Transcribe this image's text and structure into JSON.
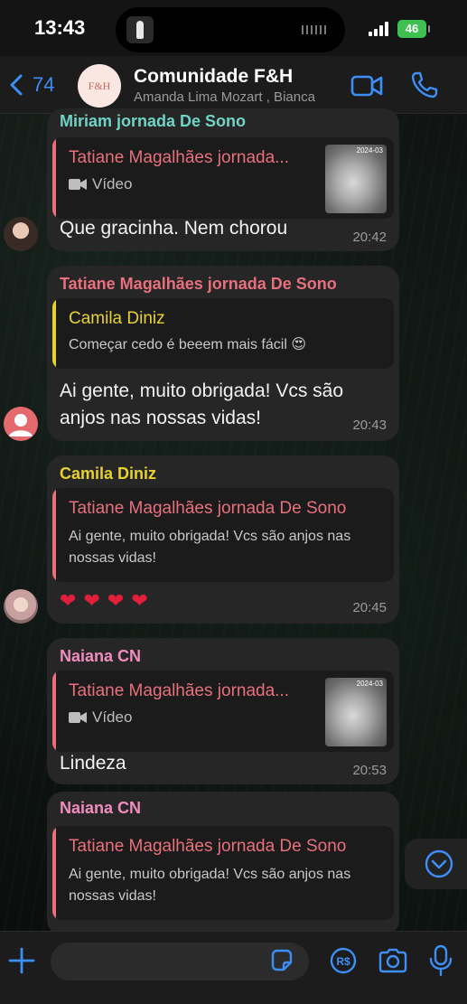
{
  "status_bar": {
    "time": "13:43",
    "battery": "46"
  },
  "header": {
    "back_count": "74",
    "avatar_text": "F&H",
    "group_name": "Comunidade F&H",
    "members": "Amanda Lima Mozart , Bianca",
    "icons": [
      "chevron-left-icon",
      "video-call-icon",
      "phone-icon"
    ]
  },
  "colors": {
    "accent": "#3d8ef7",
    "bubble": "#262626",
    "quote_bg": "#1b1b1b",
    "sender_miriam": "#6fd3c6",
    "sender_tatiane": "#e8707d",
    "sender_camila": "#e6d22e",
    "sender_naiana": "#f08cc0",
    "heart": "#e0203a"
  },
  "messages": [
    {
      "sender": "Miriam jornada De Sono",
      "quote_author": "Tatiane Magalhães jornada...",
      "quote_kind": "Vídeo",
      "thumb_timestamp": "2024-03",
      "text": "Que gracinha. Nem chorou",
      "time": "20:42"
    },
    {
      "sender": "Tatiane Magalhães jornada De Sono",
      "quote_author": "Camila  Diniz",
      "quote_text": "Começar cedo é beeem mais fácil 😍",
      "text": "Ai gente, muito obrigada! Vcs são\nanjos nas nossas vidas!",
      "time": "20:43"
    },
    {
      "sender": "Camila  Diniz",
      "quote_author": "Tatiane Magalhães jornada De Sono",
      "quote_text": "Ai gente, muito obrigada! Vcs são anjos nas nossas vidas!",
      "reaction_hearts": 4,
      "time": "20:45"
    },
    {
      "sender": "Naiana CN",
      "quote_author": "Tatiane Magalhães jornada...",
      "quote_kind": "Vídeo",
      "thumb_timestamp": "2024-03",
      "text": "Lindeza",
      "time": "20:53"
    },
    {
      "sender": "Naiana CN",
      "quote_author": "Tatiane Magalhães jornada De Sono",
      "quote_text": "Ai gente, muito obrigada! Vcs são anjos nas nossas vidas!"
    }
  ],
  "composer": {
    "placeholder": "",
    "icons": [
      "plus-icon",
      "sticker-icon",
      "pay-icon",
      "camera-icon",
      "microphone-icon"
    ]
  }
}
